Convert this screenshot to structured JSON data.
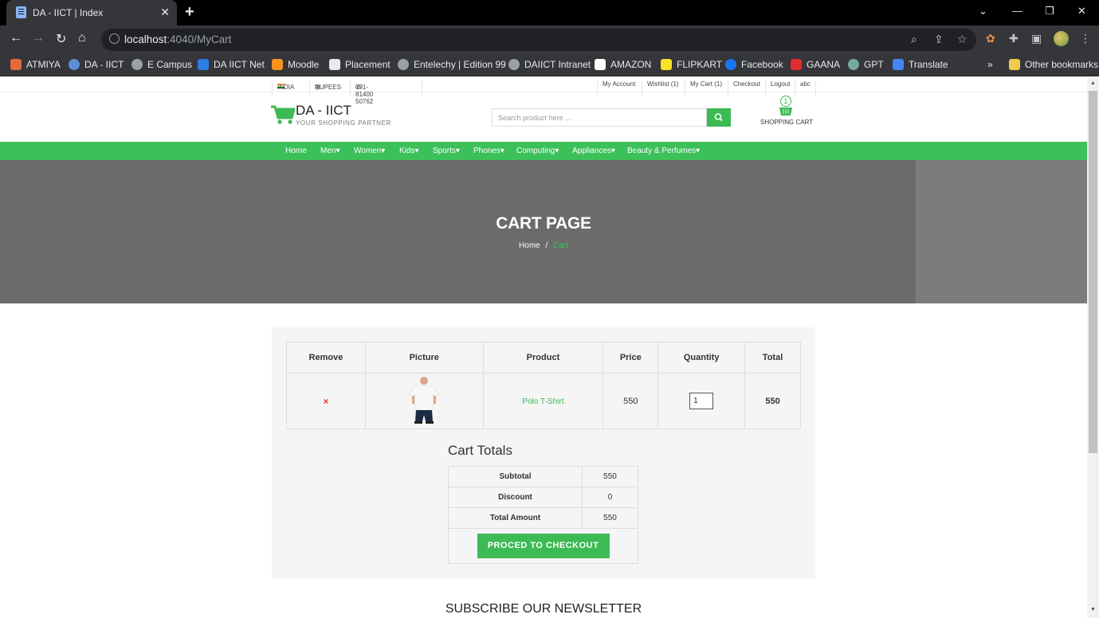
{
  "browser": {
    "tab_title": "DA - IICT | Index",
    "url_host": "localhost",
    "url_rest": ":4040/MyCart",
    "bookmarks": [
      "ATMIYA",
      "DA - IICT",
      "E Campus",
      "DA IICT Net",
      "Moodle",
      "Placement",
      "Entelechy | Edition 99",
      "DAIICT Intranet",
      "AMAZON",
      "FLIPKART",
      "Facebook",
      "GAANA",
      "GPT",
      "Translate"
    ],
    "other_bookmarks": "Other bookmarks"
  },
  "topbar": {
    "country": "INDIA",
    "currency": "RUPEES",
    "phone": "091-81400 50762",
    "links": [
      "My Account",
      "Wishlist (1)",
      "My Cart (1)",
      "Checkout",
      "Logout",
      "abc"
    ]
  },
  "header": {
    "logo_title": "DA - IICT",
    "logo_sub": "YOUR SHOPPING PARTNER",
    "search_placeholder": "Search product here ...",
    "cart_count": "1",
    "cart_label": "SHOPPING CART"
  },
  "menu": [
    "Home",
    "Men",
    "Women",
    "Kids",
    "Sports",
    "Phones",
    "Computing",
    "Appliances",
    "Beauty & Perfumes"
  ],
  "hero": {
    "title": "CART PAGE",
    "crumb_home": "Home",
    "crumb_sep": "/",
    "crumb_current": "Cart"
  },
  "cart": {
    "headers": [
      "Remove",
      "Picture",
      "Product",
      "Price",
      "Quantity",
      "Total"
    ],
    "rows": [
      {
        "remove": "×",
        "product": "Polo T-Shirt",
        "price": "550",
        "quantity": "1",
        "total": "550"
      }
    ]
  },
  "totals": {
    "title": "Cart Totals",
    "subtotal_label": "Subtotal",
    "subtotal": "550",
    "discount_label": "Discount",
    "discount": "0",
    "total_label": "Total Amount",
    "total": "550",
    "checkout_label": "PROCED TO CHECKOUT"
  },
  "newsletter": "SUBSCRIBE OUR NEWSLETTER"
}
